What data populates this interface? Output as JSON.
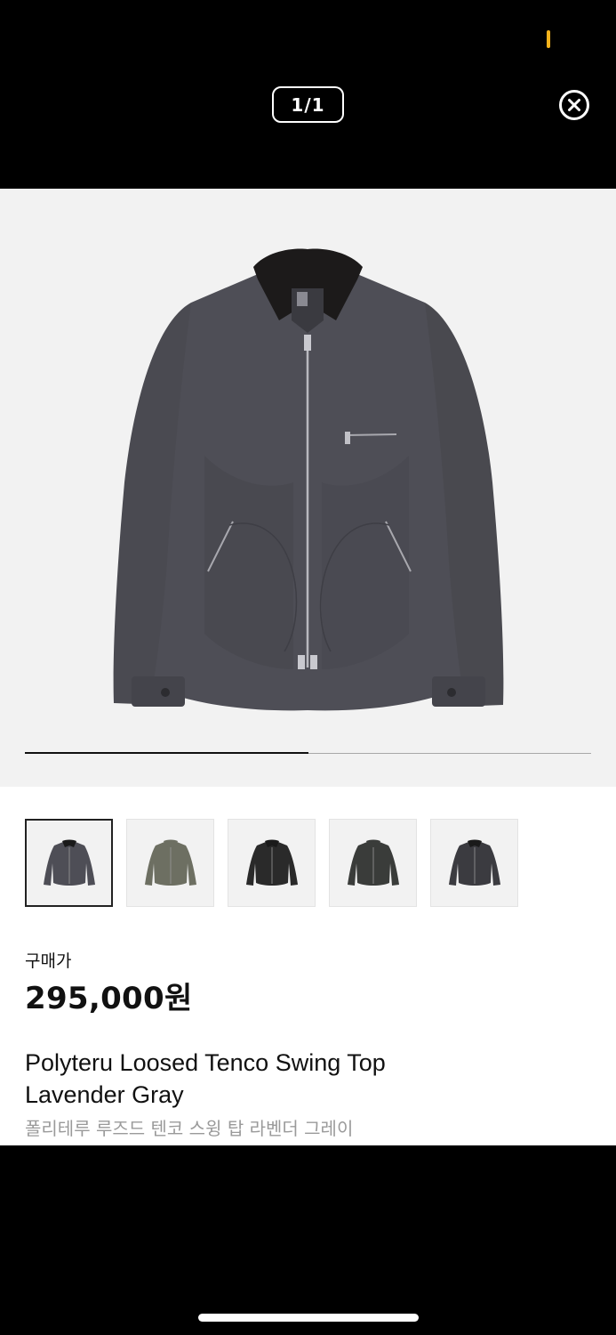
{
  "viewer": {
    "counter": "1/1",
    "close_icon": "close-circle-icon",
    "image_progress": 0.5
  },
  "thumbnails": [
    {
      "color_name": "lavender-gray",
      "color": "#4e4e56",
      "collar": "#1a1a1a",
      "selected": true
    },
    {
      "color_name": "olive",
      "color": "#6d6f62",
      "collar": "#6d6f62",
      "selected": false
    },
    {
      "color_name": "black",
      "color": "#2a2a2a",
      "collar": "#1a1a1a",
      "selected": false
    },
    {
      "color_name": "charcoal",
      "color": "#3a3c3a",
      "collar": "#3a3c3a",
      "selected": false
    },
    {
      "color_name": "dark-gray",
      "color": "#3b3b40",
      "collar": "#1a1a1a",
      "selected": false
    }
  ],
  "price": {
    "label": "구매가",
    "value": "295,000원"
  },
  "product": {
    "name_en": "Polyteru Loosed Tenco Swing Top Lavender Gray",
    "name_ko": "폴리테루 루즈드 텐코 스윙 탑 라벤더 그레이"
  },
  "colors": {
    "accent_status": "#f5b21b",
    "background_dark": "#000000",
    "photo_background": "#f2f2f2",
    "jacket_body": "#4b4b52",
    "jacket_collar": "#1c1a1a"
  }
}
